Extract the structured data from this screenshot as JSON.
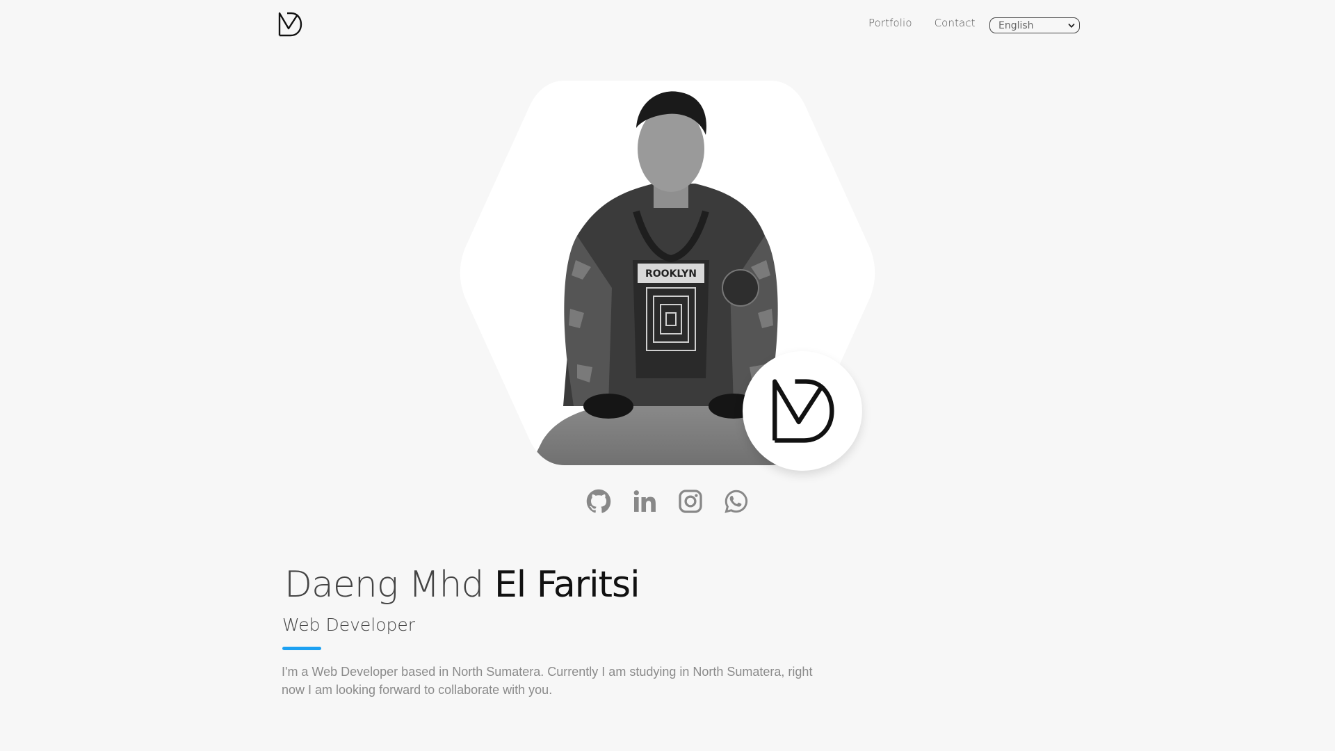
{
  "header": {
    "nav": [
      {
        "label": "Portfolio"
      },
      {
        "label": "Contact"
      }
    ],
    "language": {
      "selected": "English"
    }
  },
  "hero": {
    "photo_shirt_text": "ROOKLYN"
  },
  "socials": [
    {
      "icon": "github-icon"
    },
    {
      "icon": "linkedin-icon"
    },
    {
      "icon": "instagram-icon"
    },
    {
      "icon": "whatsapp-icon"
    }
  ],
  "intro": {
    "name_light": "Daeng Mhd ",
    "name_bold": "El Faritsi",
    "role": "Web Developer",
    "bio": "I'm a Web Developer based in North Sumatera. Currently I am studying in North Sumatera, right now I am looking forward to collaborate with you."
  },
  "colors": {
    "accent": "#1da1f2",
    "background": "#f7f7f7",
    "icon_gray": "#888888"
  }
}
